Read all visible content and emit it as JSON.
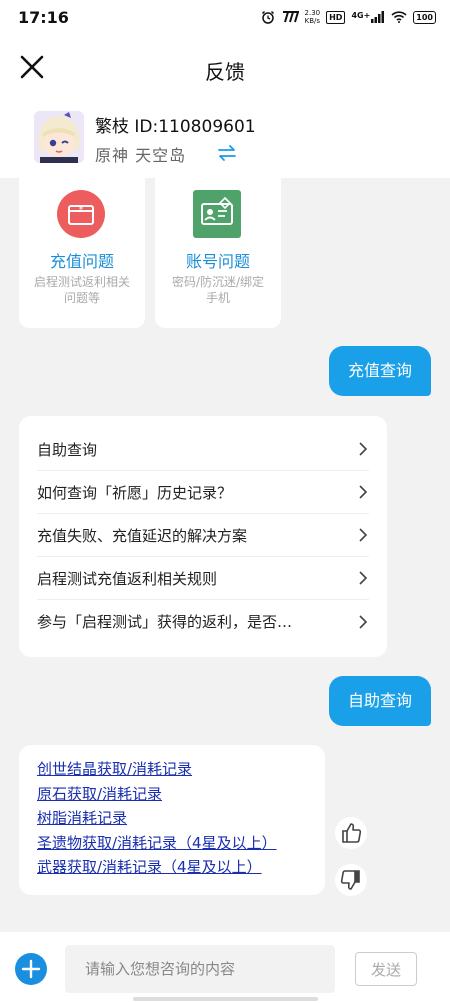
{
  "status_bar": {
    "time": "17:16",
    "net_speed_value": "2.30",
    "net_speed_unit": "KB/s",
    "hd_label": "HD",
    "network": "4G+",
    "battery": "100"
  },
  "header": {
    "title": "反馈"
  },
  "profile": {
    "name_id": "繁枝 ID:110809601",
    "game_server": "原神  天空岛"
  },
  "categories": [
    {
      "title": "充值问题",
      "desc": "启程测试返利相关问题等"
    },
    {
      "title": "账号问题",
      "desc": "密码/防沉迷/绑定手机"
    }
  ],
  "chat": {
    "user_msg_1": "充值查询",
    "menu_items": [
      "自助查询",
      "如何查询「祈愿」历史记录？",
      "充值失败、充值延迟的解决方案",
      "启程测试充值返利相关规则",
      "参与「启程测试」获得的返利，是否…"
    ],
    "user_msg_2": "自助查询",
    "links": [
      "创世结晶获取/消耗记录",
      "原石获取/消耗记录",
      "树脂消耗记录",
      "圣遗物获取/消耗记录（4星及以上）",
      "武器获取/消耗记录（4星及以上）"
    ]
  },
  "input_bar": {
    "placeholder": "请输入您想咨询的内容",
    "send_label": "发送"
  },
  "colors": {
    "accent": "#1aa0e8",
    "recharge_icon": "#ee5d5d",
    "account_icon": "#4fa36a",
    "link": "#1a2fb0"
  }
}
